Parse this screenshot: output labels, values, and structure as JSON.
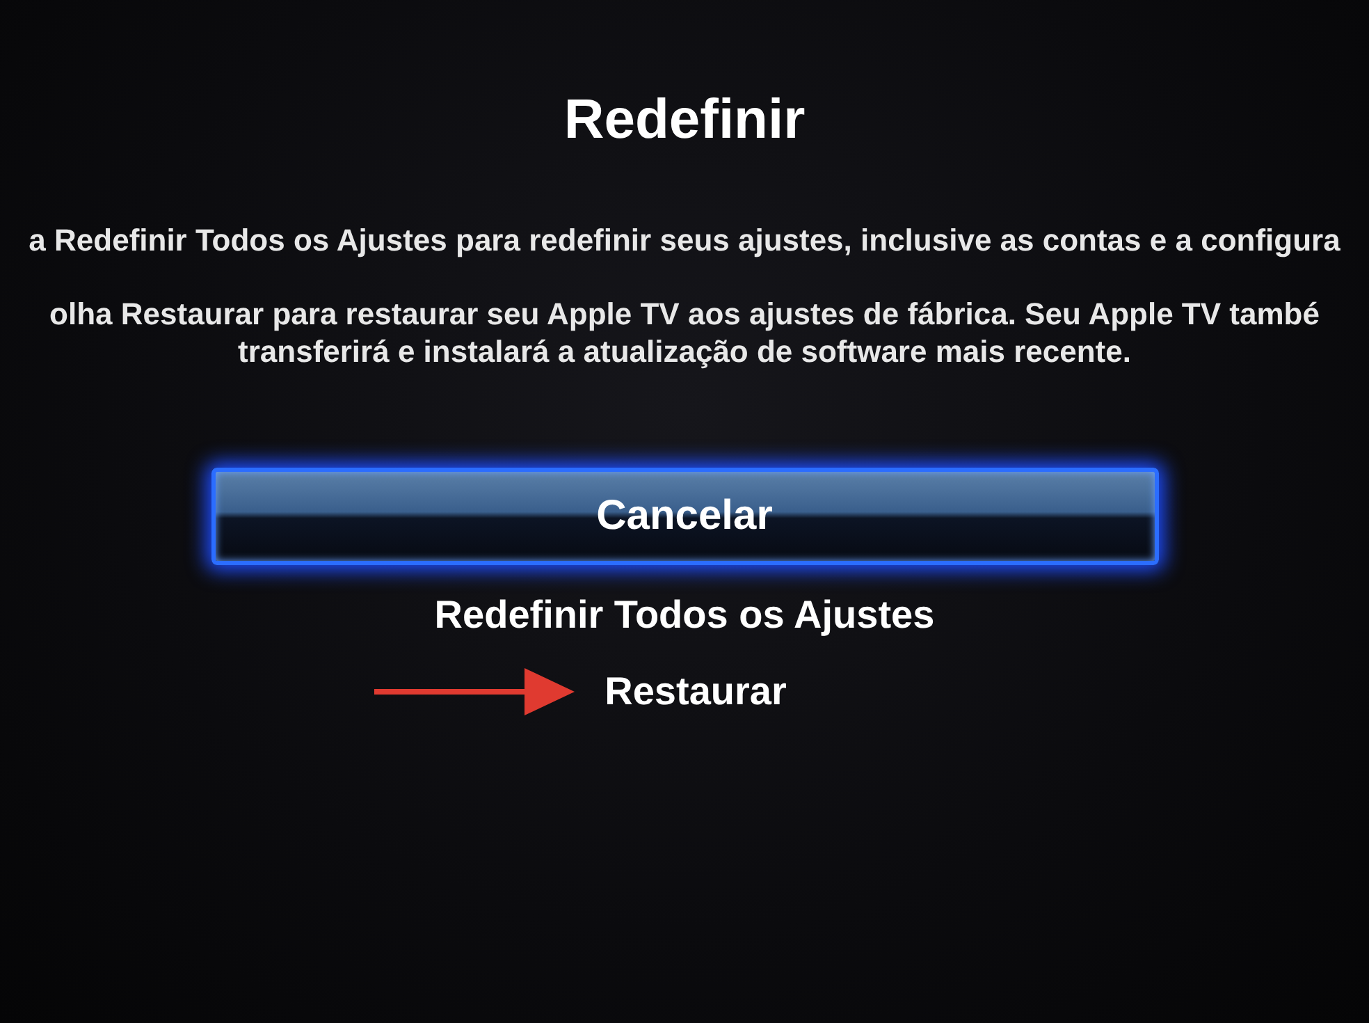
{
  "title": "Redefinir",
  "paragraphs": [
    {
      "lines": [
        "a Redefinir Todos os Ajustes para redefinir seus ajustes, inclusive as contas e a configura"
      ]
    },
    {
      "lines": [
        "olha Restaurar para restaurar seu Apple TV aos ajustes de fábrica. Seu Apple TV també",
        "transferirá e instalará a atualização de software mais recente."
      ]
    }
  ],
  "menu": [
    {
      "label": "Cancelar",
      "selected": true
    },
    {
      "label": "Redefinir Todos os Ajustes",
      "selected": false
    },
    {
      "label": "Restaurar",
      "selected": false,
      "pointer": true
    }
  ]
}
